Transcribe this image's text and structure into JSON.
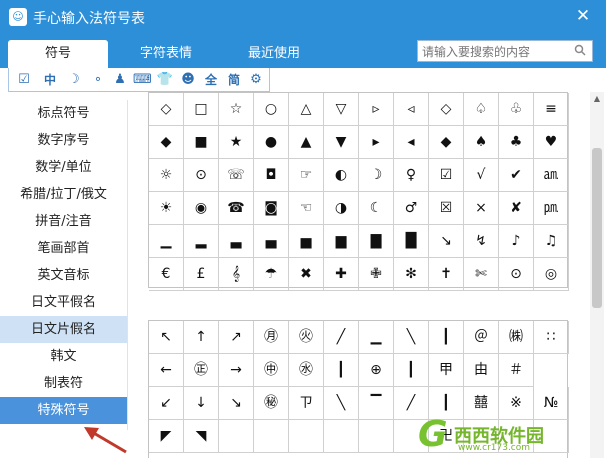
{
  "window": {
    "title": "手心输入法符号表",
    "close_glyph": "✕"
  },
  "tabs": [
    {
      "label": "符号",
      "active": true
    },
    {
      "label": "字符表情",
      "active": false
    },
    {
      "label": "最近使用",
      "active": false
    }
  ],
  "search": {
    "placeholder": "请输入要搜索的内容"
  },
  "iconbar": [
    {
      "icon": "check-box-icon",
      "glyph": "☑"
    },
    {
      "icon": "chinese-char-icon",
      "glyph": "中"
    },
    {
      "icon": "moon-icon",
      "glyph": "☽"
    },
    {
      "icon": "dots-icon",
      "glyph": "∘"
    },
    {
      "icon": "person-icon",
      "glyph": "♟"
    },
    {
      "icon": "keyboard-icon",
      "glyph": "⌨"
    },
    {
      "icon": "shirt-icon",
      "glyph": "👕"
    },
    {
      "icon": "face-icon",
      "glyph": "☻"
    },
    {
      "icon": "full-width-icon",
      "glyph": "全"
    },
    {
      "icon": "simplified-icon",
      "glyph": "简"
    },
    {
      "icon": "gear-icon",
      "glyph": "⚙"
    }
  ],
  "sidebar": {
    "items": [
      {
        "label": "标点符号"
      },
      {
        "label": "数字序号"
      },
      {
        "label": "数学/单位"
      },
      {
        "label": "希腊/拉丁/俄文"
      },
      {
        "label": "拼音/注音"
      },
      {
        "label": "笔画部首"
      },
      {
        "label": "英文音标"
      },
      {
        "label": "日文平假名"
      },
      {
        "label": "日文片假名"
      },
      {
        "label": "韩文"
      },
      {
        "label": "制表符"
      },
      {
        "label": "特殊符号"
      }
    ],
    "hover_index": 8,
    "selected_index": 11
  },
  "symbols_grid_1": [
    [
      "◇",
      "□",
      "☆",
      "○",
      "△",
      "▽",
      "▹",
      "◃",
      "◇",
      "♤",
      "♧",
      "≡"
    ],
    [
      "◆",
      "■",
      "★",
      "●",
      "▲",
      "▼",
      "▸",
      "◂",
      "◆",
      "♠",
      "♣",
      "♥"
    ],
    [
      "☼",
      "⊙",
      "☏",
      "◘",
      "☞",
      "◐",
      "☽",
      "♀",
      "☑",
      "√",
      "✔",
      "㏂"
    ],
    [
      "☀",
      "◉",
      "☎",
      "◙",
      "☜",
      "◑",
      "☾",
      "♂",
      "☒",
      "×",
      "✘",
      "㏘"
    ],
    [
      "▁",
      "▂",
      "▃",
      "▄",
      "▅",
      "▆",
      "▇",
      "█",
      "↘",
      "↯",
      "♪",
      "♫"
    ],
    [
      "€",
      "£",
      "𝄞",
      "☂",
      "✖",
      "✚",
      "✙",
      "✻",
      "✝",
      "✄",
      "⊙",
      "◎"
    ]
  ],
  "symbols_grid_2": [
    [
      "↖",
      "↑",
      "↗",
      "㊊",
      "㊋",
      "╱",
      "▁",
      "╲",
      "┃",
      "＠",
      "㈱",
      "∷"
    ],
    [
      "←",
      "㊣",
      "→",
      "㊥",
      "㊌",
      "┃",
      "⊕",
      "┃",
      "甲",
      "由",
      "＃"
    ],
    [
      "↙",
      "↓",
      "↘",
      "㊙",
      "ㄗ",
      "╲",
      "▔",
      "╱",
      "┃",
      "囍",
      "※",
      "№"
    ],
    [
      "◤",
      "◥",
      "",
      "",
      "",
      "",
      "",
      "",
      "卍",
      "",
      "",
      ""
    ]
  ],
  "watermark": {
    "logo": "G",
    "text": "西西软件园",
    "url": "www.cr173.com"
  },
  "colors": {
    "brand_blue": "#2e8fd9",
    "selected_bg": "#4a93dc",
    "hover_bg": "#cfe1f5",
    "arrow_red": "#c0392b",
    "watermark_green": "#76b62d"
  }
}
